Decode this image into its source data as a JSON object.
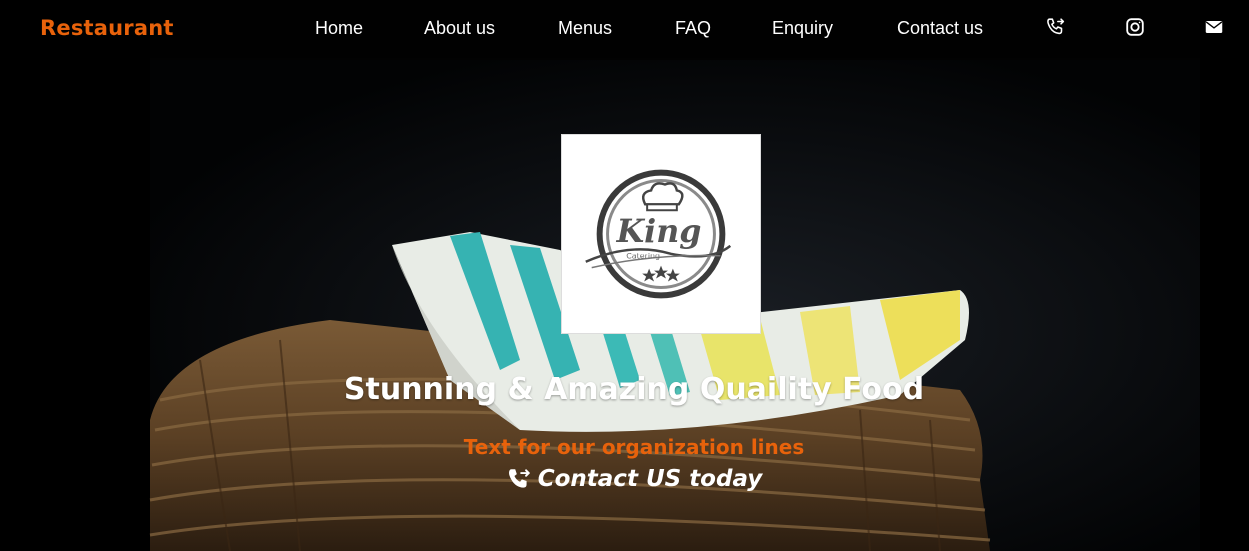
{
  "brand": {
    "name": "Restaurant",
    "color": "#e8620b"
  },
  "nav": {
    "items": [
      {
        "label": "Home"
      },
      {
        "label": "About us"
      },
      {
        "label": "Menus"
      },
      {
        "label": "FAQ"
      },
      {
        "label": "Enquiry"
      },
      {
        "label": "Contact us"
      }
    ],
    "icons": [
      "phone-forward-icon",
      "instagram-icon",
      "mail-icon"
    ]
  },
  "hero": {
    "logo": {
      "wordmark": "King",
      "tagline": "Catering",
      "stars": 3
    },
    "title": "Stunning & Amazing Quaility Food",
    "subtitle": "Text for our organization lines",
    "cta": "Contact US today",
    "accent_color": "#e8620b",
    "text_color": "#ffffff"
  }
}
